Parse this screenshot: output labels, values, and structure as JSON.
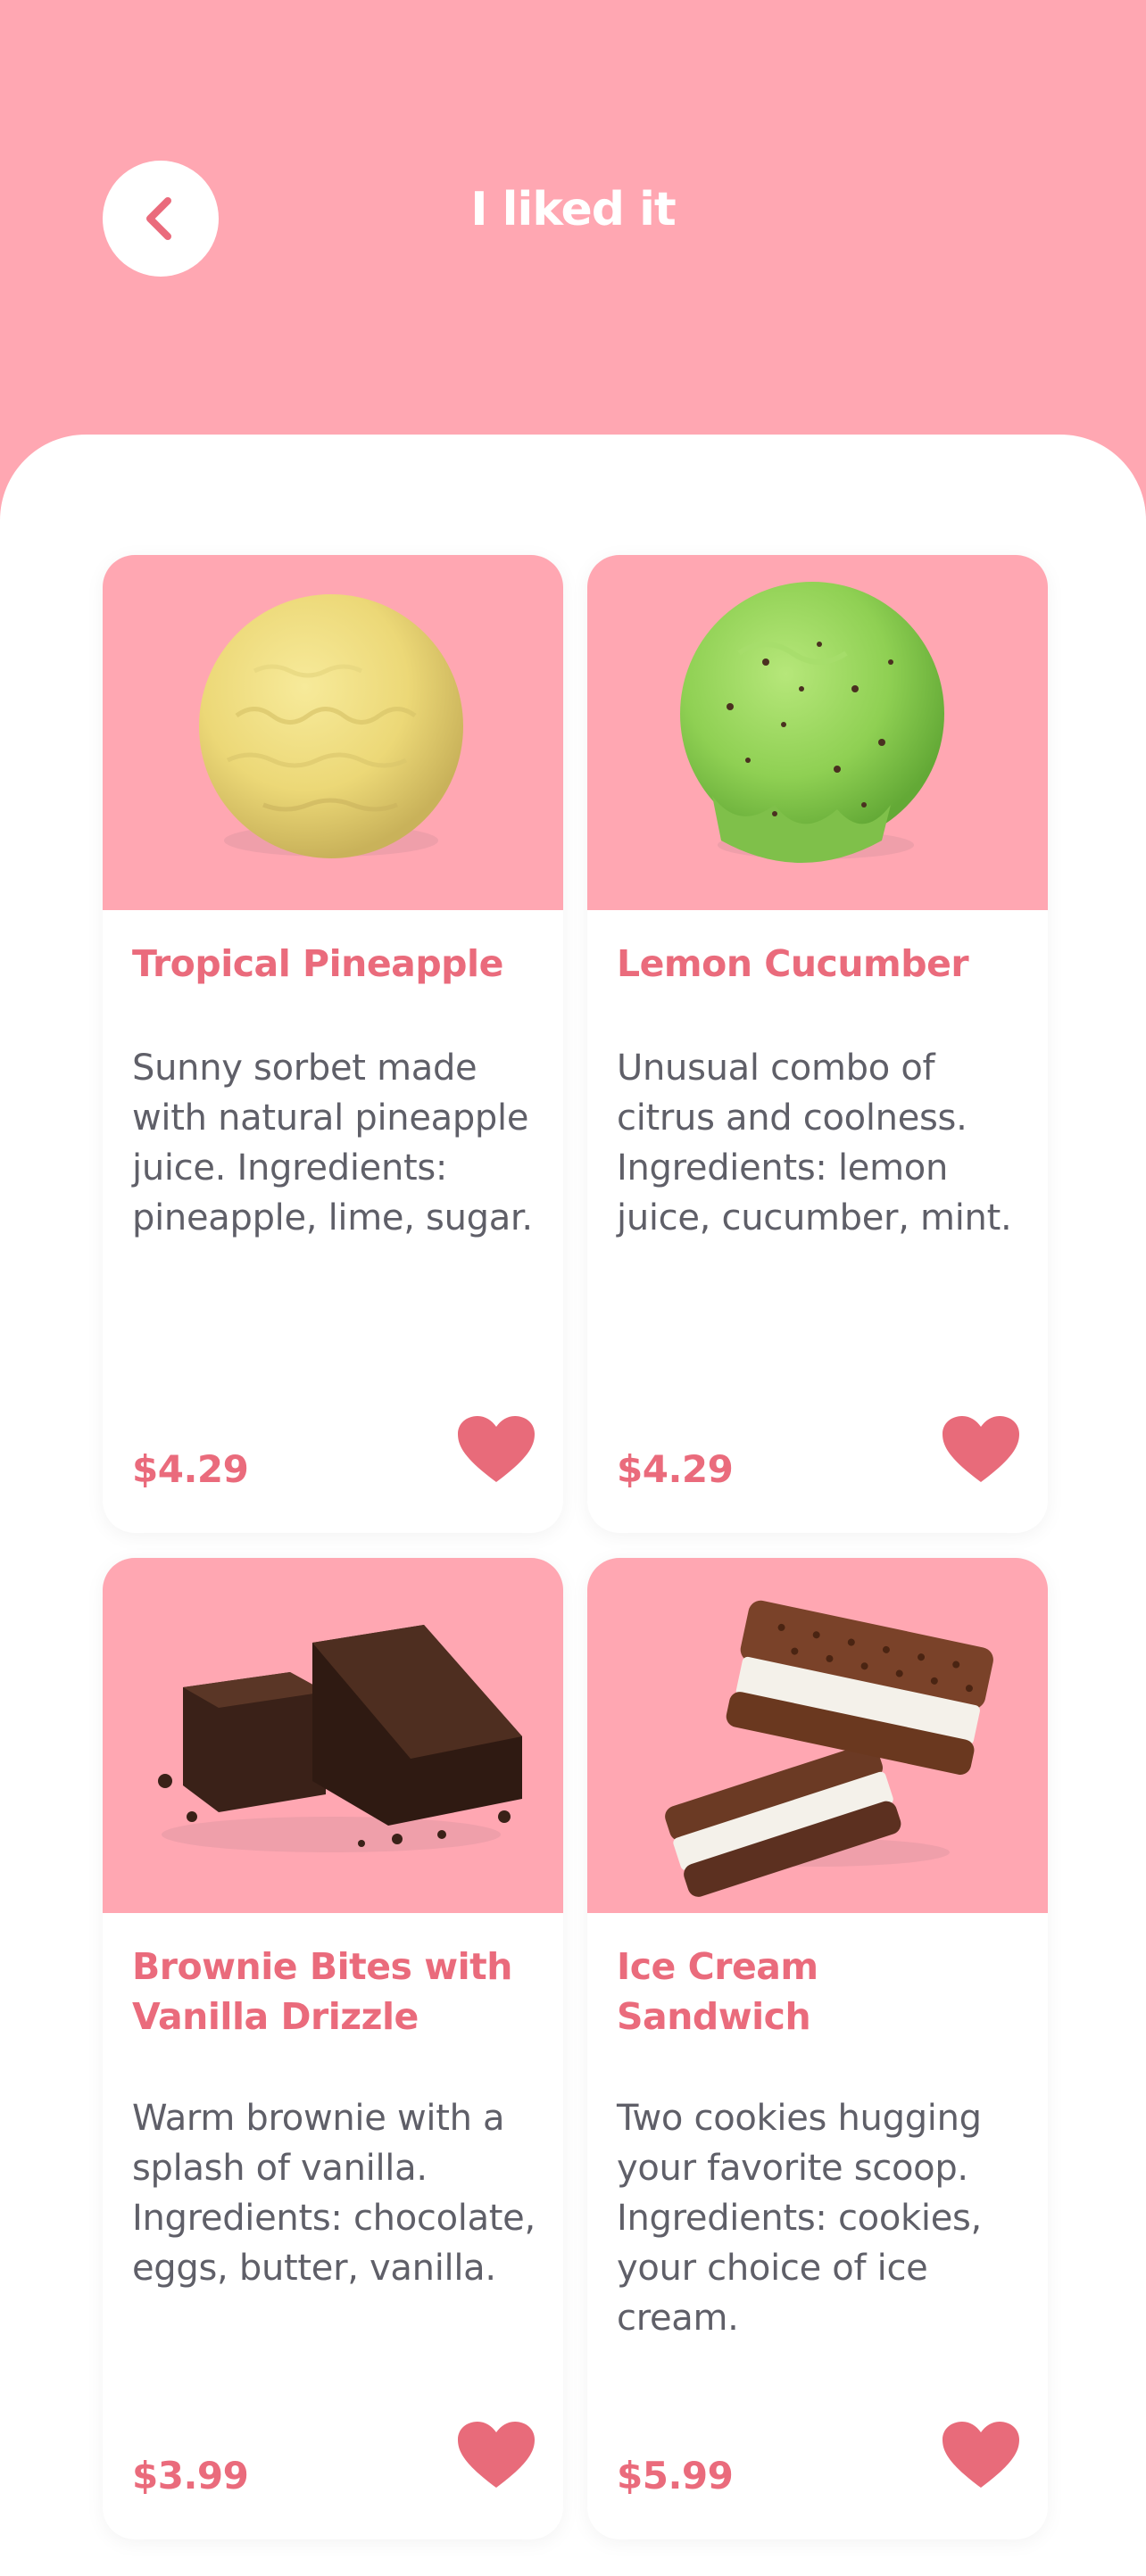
{
  "header": {
    "title": "I liked it",
    "back_icon": "chevron-left-icon"
  },
  "colors": {
    "accent": "#ffa7b2",
    "price": "#ea6b7c",
    "heart": "#e86b7a",
    "text": "#5f5f68"
  },
  "products": [
    {
      "title": "Tropical Pineapple",
      "description": "Sunny sorbet made with natural pineapple juice. Ingredients: pineapple, lime, sugar.",
      "price": "$4.29",
      "image": "pineapple-scoop-image",
      "favorite": true
    },
    {
      "title": "Lemon Cucumber",
      "description": "Unusual combo of citrus and coolness. Ingredients: lemon juice, cucumber, mint.",
      "price": "$4.29",
      "image": "cucumber-scoop-image",
      "favorite": true
    },
    {
      "title": "Brownie Bites with Vanilla Drizzle",
      "description": "Warm brownie with a splash of vanilla. Ingredients: chocolate, eggs, butter, vanilla.",
      "price": "$3.99",
      "image": "brownie-image",
      "favorite": true
    },
    {
      "title": "Ice Cream Sandwich",
      "description": "Two cookies hugging your favorite scoop. Ingredients: cookies, your choice of ice cream.",
      "price": "$5.99",
      "image": "ice-cream-sandwich-image",
      "favorite": true
    }
  ]
}
